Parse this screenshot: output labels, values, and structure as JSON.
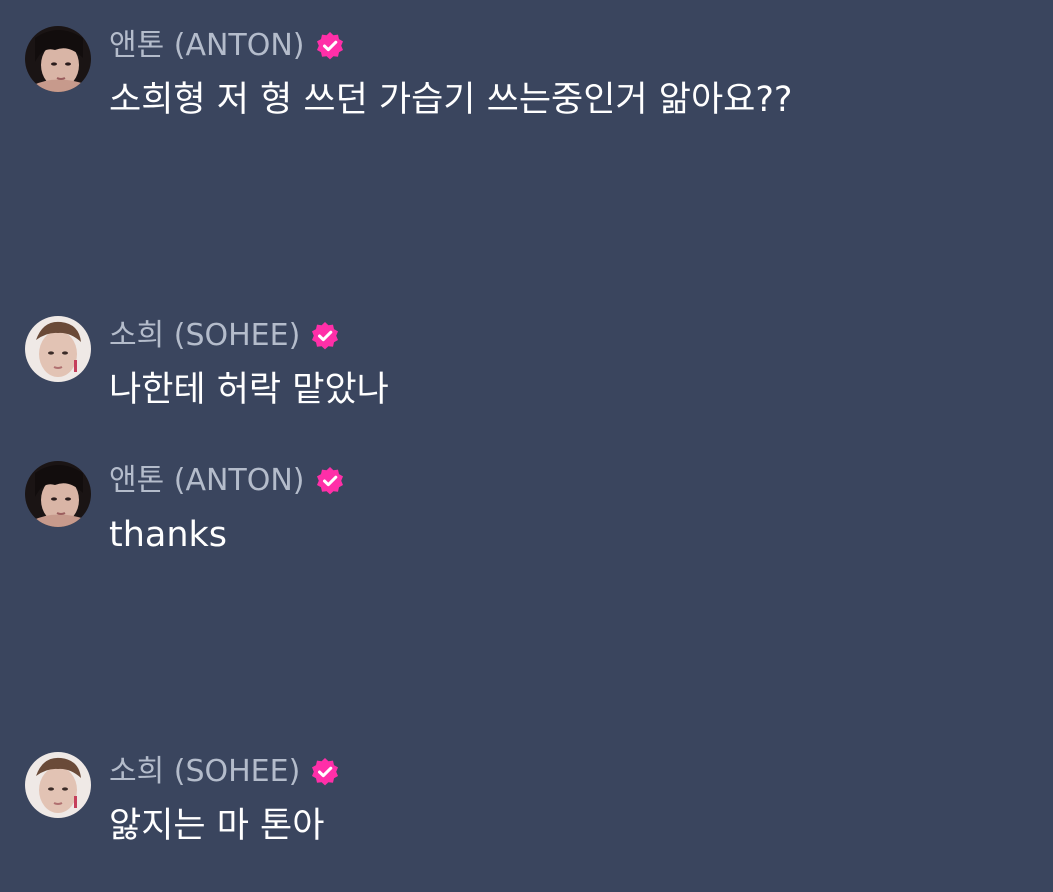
{
  "colors": {
    "background": "#3a455e",
    "author_text": "#b4bccb",
    "message_text": "#ffffff",
    "verified_badge": "#ff2fa8"
  },
  "messages": [
    {
      "author": "앤톤 (ANTON)",
      "text": "소희형 저 형 쓰던 가습기 쓰는중인거 앎아요??",
      "avatar": "anton-avatar",
      "verified_icon": "verified-badge-icon"
    },
    {
      "author": "소희 (SOHEE)",
      "text": "나한테 허락 맡았나",
      "avatar": "sohee-avatar",
      "verified_icon": "verified-badge-icon"
    },
    {
      "author": "앤톤 (ANTON)",
      "text": "thanks",
      "avatar": "anton-avatar",
      "verified_icon": "verified-badge-icon"
    },
    {
      "author": "소희 (SOHEE)",
      "text": "앓지는 마 톤아",
      "avatar": "sohee-avatar",
      "verified_icon": "verified-badge-icon"
    }
  ]
}
